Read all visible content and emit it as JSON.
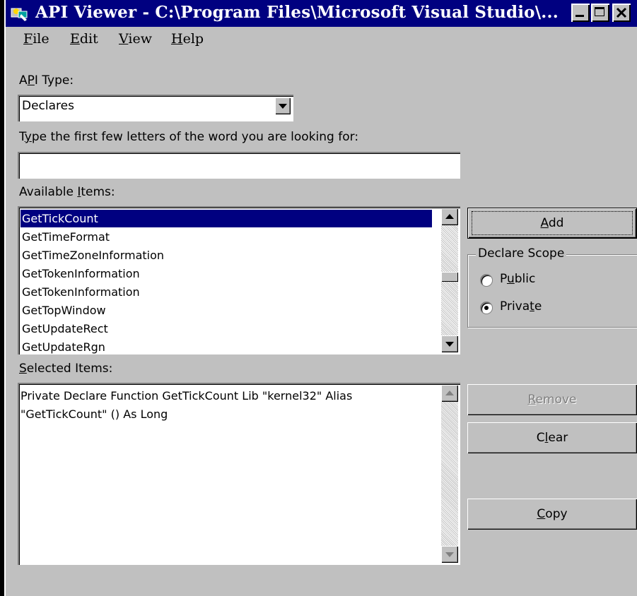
{
  "window": {
    "title": "API Viewer - C:\\Program Files\\Microsoft Visual Studio\\...",
    "buttons": {
      "minimize": "minimize-icon",
      "maximize": "maximize-icon",
      "close": "close-icon"
    }
  },
  "menu": {
    "file": {
      "accel": "F",
      "rest": "ile"
    },
    "edit": {
      "accel": "E",
      "rest": "dit"
    },
    "view": {
      "accel": "V",
      "rest": "iew"
    },
    "help": {
      "accel": "H",
      "rest": "elp"
    }
  },
  "api_type": {
    "label_pre": "A",
    "label_accel": "P",
    "label_post": "I Type:",
    "selected": "Declares"
  },
  "search": {
    "label_pre": "T",
    "label_accel": "y",
    "label_post": "pe the first few letters of the word you are looking for:",
    "value": ""
  },
  "available": {
    "label_pre": "Available ",
    "label_accel": "I",
    "label_post": "tems:",
    "items": [
      "GetTickCount",
      "GetTimeFormat",
      "GetTimeZoneInformation",
      "GetTokenInformation",
      "GetTokenInformation",
      "GetTopWindow",
      "GetUpdateRect",
      "GetUpdateRgn"
    ],
    "selected_index": 0
  },
  "add_button": {
    "accel": "A",
    "rest": "dd"
  },
  "declare_scope": {
    "title": "Declare Scope",
    "public": {
      "pre": "P",
      "accel": "u",
      "post": "blic"
    },
    "private": {
      "pre": "Priva",
      "accel": "t",
      "post": "e"
    },
    "selected": "private"
  },
  "selected": {
    "label_pre": "",
    "label_accel": "S",
    "label_post": "elected Items:",
    "text_line1": "Private Declare Function GetTickCount Lib \"kernel32\" Alias",
    "text_line2": "\"GetTickCount\" () As Long"
  },
  "remove_button": {
    "accel": "R",
    "rest": "emove"
  },
  "clear_button": {
    "pre": "C",
    "accel": "l",
    "post": "ear"
  },
  "copy_button": {
    "accel": "C",
    "rest": "opy"
  },
  "colors": {
    "titlebar": "#000080",
    "face": "#c0c0c0",
    "selection": "#000080"
  }
}
